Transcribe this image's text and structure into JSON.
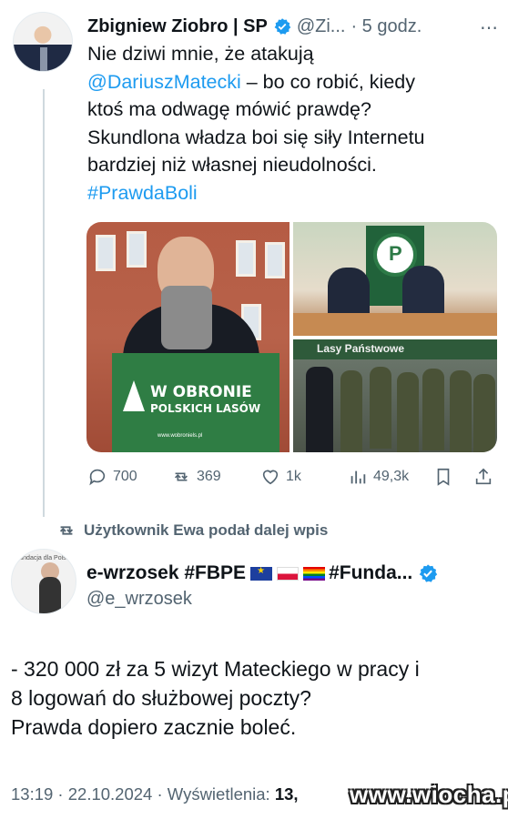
{
  "tweet1": {
    "author_name": "Zbigniew Ziobro | SP",
    "handle": "@Zi...",
    "time": "· 5 godz.",
    "more_icon": "⋯",
    "lines": [
      "Nie dziwi mnie, że atakują",
      "@DariuszMatecki",
      " – bo co robić, kiedy",
      "ktoś ma odwagę mówić prawdę?",
      "Skundlona władza boi się siły Internetu",
      "bardziej niż własnej nieudolności.",
      "#PrawdaBoli"
    ],
    "media": {
      "sign_title_1": "W OBRONIE",
      "sign_title_2": "POLSKICH LASÓW",
      "sign_url": "www.wobroniels.pl",
      "banner_text": "Lasy Państwowe",
      "logo_letter": "P"
    },
    "actions": {
      "replies": "700",
      "retweets": "369",
      "likes": "1k",
      "views": "49,3k"
    }
  },
  "retweet_note": "Użytkownik Ewa podał dalej wpis",
  "tweet2": {
    "author_name": "e-wrzosek #FBPE",
    "author_tail": "#Funda...",
    "handle": "@e_wrzosek",
    "avatar_text": "Fundacja dla Polski",
    "lines": [
      "- 320 000 zł za 5 wizyt Mateckiego w pracy i",
      "8 logowań do służbowej poczty?",
      "Prawda dopiero zacznie boleć."
    ],
    "time": "13:19 · 22.10.2024 · Wyświetlenia: ",
    "views": "13,"
  },
  "watermark": "www.wiocha.pl",
  "colors": {
    "link": "#1d9bf0",
    "muted": "#536471",
    "verified": "#1d9bf0"
  }
}
